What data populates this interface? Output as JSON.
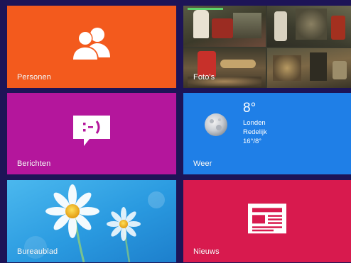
{
  "tiles": {
    "personen": {
      "label": "Personen",
      "color": "#f35a1d",
      "icon": "people-icon"
    },
    "fotos": {
      "label": "Foto's",
      "color": "#3a3a2e",
      "icon": "photo-collage"
    },
    "berichten": {
      "label": "Berichten",
      "color": "#b4169c",
      "icon": "message-icon"
    },
    "weer": {
      "label": "Weer",
      "color": "#1f7fe7",
      "icon": "moon-icon",
      "temperature": "8°",
      "city": "Londen",
      "condition": "Redelijk",
      "range": "16°/8°"
    },
    "bureaublad": {
      "label": "Bureaublad",
      "color": "#2b9de0",
      "icon": "daisy-wallpaper"
    },
    "nieuws": {
      "label": "Nieuws",
      "color": "#d81a4e",
      "icon": "newspaper-icon"
    }
  },
  "colors": {
    "background": "#1d1457"
  }
}
